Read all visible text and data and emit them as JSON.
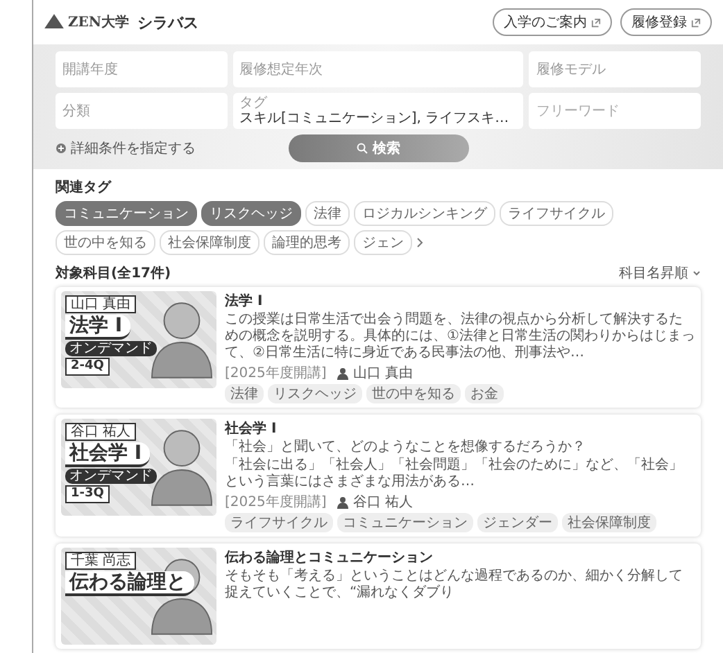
{
  "header": {
    "logo_text": "ZEN大学",
    "title": "シラバス",
    "links": [
      {
        "label": "入学のご案内"
      },
      {
        "label": "履修登録"
      }
    ]
  },
  "search": {
    "fields": [
      {
        "label": "開講年度"
      },
      {
        "label": "履修想定年次"
      },
      {
        "label": "履修モデル"
      },
      {
        "label": "分類"
      },
      {
        "label": "タグ",
        "value": "スキル[コミュニケーション], ライフスキ…"
      },
      {
        "placeholder": "フリーワード"
      }
    ],
    "advanced_link": "詳細条件を指定する",
    "search_button": "検索"
  },
  "related_tags": {
    "heading": "関連タグ",
    "tags": [
      {
        "label": "コミュニケーション",
        "selected": true
      },
      {
        "label": "リスクヘッジ",
        "selected": true
      },
      {
        "label": "法律",
        "selected": false
      },
      {
        "label": "ロジカルシンキング",
        "selected": false
      },
      {
        "label": "ライフサイクル",
        "selected": false
      },
      {
        "label": "世の中を知る",
        "selected": false
      },
      {
        "label": "社会保障制度",
        "selected": false
      },
      {
        "label": "論理的思考",
        "selected": false
      },
      {
        "label": "ジェン",
        "selected": false
      }
    ]
  },
  "results": {
    "heading": "対象科目(全17件)",
    "sort": "科目名昇順"
  },
  "courses": [
    {
      "thumbnail": {
        "instructor": "山口 真由",
        "title": "法学 I",
        "delivery": "オンデマンド",
        "term": "2-4Q"
      },
      "title": "法学 I",
      "description": [
        "この授業は日常生活で出会う問題を、法律の視点から分析して解決するための概念を説明する。具体的には、①法律と日常生活の関わりからはじまって、②日常生活に特に身近である民事法の他、刑事法や…"
      ],
      "year": "[2025年度開講]",
      "instructor": "山口 真由",
      "tags": [
        "法律",
        "リスクヘッジ",
        "世の中を知る",
        "お金"
      ]
    },
    {
      "thumbnail": {
        "instructor": "谷口 祐人",
        "title": "社会学 I",
        "delivery": "オンデマンド",
        "term": "1-3Q"
      },
      "title": "社会学 I",
      "description": [
        "「社会」と聞いて、どのようなことを想像するだろうか？",
        "「社会に出る」「社会人」「社会問題」「社会のために」など、「社会」という言葉にはさまざまな用法がある…"
      ],
      "year": "[2025年度開講]",
      "instructor": "谷口 祐人",
      "tags": [
        "ライフサイクル",
        "コミュニケーション",
        "ジェンダー",
        "社会保障制度"
      ]
    },
    {
      "thumbnail": {
        "instructor": "千葉 尚志",
        "title": "伝わる論理と"
      },
      "title": "伝わる論理とコミュニケーション",
      "description": [
        "そもそも「考える」ということはどんな過程であるのか、細かく分解して捉えていくことで、“漏れなくダブり"
      ]
    }
  ]
}
